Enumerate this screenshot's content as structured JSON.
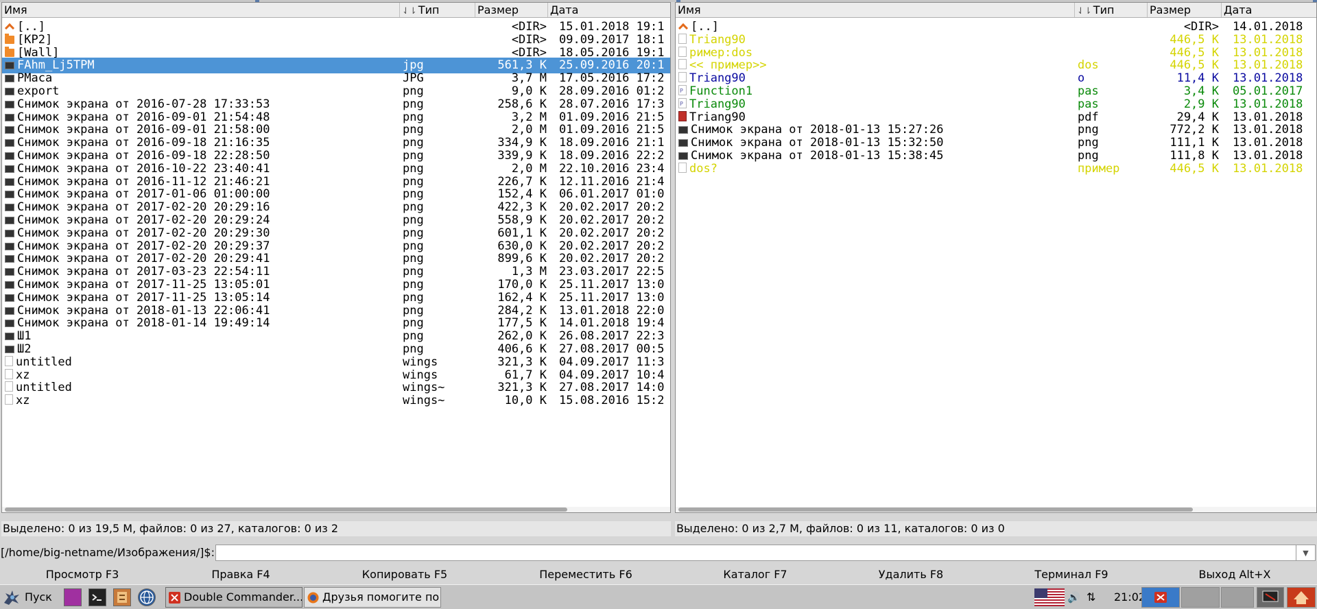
{
  "left_panel": {
    "columns": {
      "name": "Имя",
      "type": "Тип",
      "size": "Размер",
      "date": "Дата"
    },
    "rows": [
      {
        "icon": "up",
        "name": "[..]",
        "type": "",
        "size": "<DIR>",
        "date": "15.01.2018 19:1"
      },
      {
        "icon": "folder",
        "name": "[KP2]",
        "type": "",
        "size": "<DIR>",
        "date": "09.09.2017 18:1"
      },
      {
        "icon": "folder",
        "name": "[Wall]",
        "type": "",
        "size": "<DIR>",
        "date": "18.05.2016 19:1"
      },
      {
        "icon": "image",
        "name": "FAhm_Lj5TPM",
        "type": "jpg",
        "size": "561,3 K",
        "date": "25.09.2016 20:1",
        "selected": true
      },
      {
        "icon": "image",
        "name": "PMaca",
        "type": "JPG",
        "size": "3,7 M",
        "date": "17.05.2016 17:2"
      },
      {
        "icon": "image",
        "name": "export",
        "type": "png",
        "size": "9,0 K",
        "date": "28.09.2016 01:2"
      },
      {
        "icon": "image",
        "name": "Снимок экрана от 2016-07-28 17:33:53",
        "type": "png",
        "size": "258,6 K",
        "date": "28.07.2016 17:3"
      },
      {
        "icon": "image",
        "name": "Снимок экрана от 2016-09-01 21:54:48",
        "type": "png",
        "size": "3,2 M",
        "date": "01.09.2016 21:5"
      },
      {
        "icon": "image",
        "name": "Снимок экрана от 2016-09-01 21:58:00",
        "type": "png",
        "size": "2,0 M",
        "date": "01.09.2016 21:5"
      },
      {
        "icon": "image",
        "name": "Снимок экрана от 2016-09-18 21:16:35",
        "type": "png",
        "size": "334,9 K",
        "date": "18.09.2016 21:1"
      },
      {
        "icon": "image",
        "name": "Снимок экрана от 2016-09-18 22:28:50",
        "type": "png",
        "size": "339,9 K",
        "date": "18.09.2016 22:2"
      },
      {
        "icon": "image",
        "name": "Снимок экрана от 2016-10-22 23:40:41",
        "type": "png",
        "size": "2,0 M",
        "date": "22.10.2016 23:4"
      },
      {
        "icon": "image",
        "name": "Снимок экрана от 2016-11-12 21:46:21",
        "type": "png",
        "size": "226,7 K",
        "date": "12.11.2016 21:4"
      },
      {
        "icon": "image",
        "name": "Снимок экрана от 2017-01-06 01:00:00",
        "type": "png",
        "size": "152,4 K",
        "date": "06.01.2017 01:0"
      },
      {
        "icon": "image",
        "name": "Снимок экрана от 2017-02-20 20:29:16",
        "type": "png",
        "size": "422,3 K",
        "date": "20.02.2017 20:2"
      },
      {
        "icon": "image",
        "name": "Снимок экрана от 2017-02-20 20:29:24",
        "type": "png",
        "size": "558,9 K",
        "date": "20.02.2017 20:2"
      },
      {
        "icon": "image",
        "name": "Снимок экрана от 2017-02-20 20:29:30",
        "type": "png",
        "size": "601,1 K",
        "date": "20.02.2017 20:2"
      },
      {
        "icon": "image",
        "name": "Снимок экрана от 2017-02-20 20:29:37",
        "type": "png",
        "size": "630,0 K",
        "date": "20.02.2017 20:2"
      },
      {
        "icon": "image",
        "name": "Снимок экрана от 2017-02-20 20:29:41",
        "type": "png",
        "size": "899,6 K",
        "date": "20.02.2017 20:2"
      },
      {
        "icon": "image",
        "name": "Снимок экрана от 2017-03-23 22:54:11",
        "type": "png",
        "size": "1,3 M",
        "date": "23.03.2017 22:5"
      },
      {
        "icon": "image",
        "name": "Снимок экрана от 2017-11-25 13:05:01",
        "type": "png",
        "size": "170,0 K",
        "date": "25.11.2017 13:0"
      },
      {
        "icon": "image",
        "name": "Снимок экрана от 2017-11-25 13:05:14",
        "type": "png",
        "size": "162,4 K",
        "date": "25.11.2017 13:0"
      },
      {
        "icon": "image",
        "name": "Снимок экрана от 2018-01-13 22:06:41",
        "type": "png",
        "size": "284,2 K",
        "date": "13.01.2018 22:0"
      },
      {
        "icon": "image",
        "name": "Снимок экрана от 2018-01-14 19:49:14",
        "type": "png",
        "size": "177,5 K",
        "date": "14.01.2018 19:4"
      },
      {
        "icon": "image",
        "name": "Ш1",
        "type": "png",
        "size": "262,0 K",
        "date": "26.08.2017 22:3"
      },
      {
        "icon": "image",
        "name": "Ш2",
        "type": "png",
        "size": "406,6 K",
        "date": "27.08.2017 00:5"
      },
      {
        "icon": "doc",
        "name": "untitled",
        "type": "wings",
        "size": "321,3 K",
        "date": "04.09.2017 11:3"
      },
      {
        "icon": "doc",
        "name": "xz",
        "type": "wings",
        "size": "61,7 K",
        "date": "04.09.2017 10:4"
      },
      {
        "icon": "doc",
        "name": "untitled",
        "type": "wings~",
        "size": "321,3 K",
        "date": "27.08.2017 14:0"
      },
      {
        "icon": "doc",
        "name": "xz",
        "type": "wings~",
        "size": "10,0 K",
        "date": "15.08.2016 15:2"
      }
    ],
    "status": "Выделено: 0 из 19,5 M, файлов: 0 из 27, каталогов: 0 из 2"
  },
  "right_panel": {
    "columns": {
      "name": "Имя",
      "type": "Тип",
      "size": "Размер",
      "date": "Дата"
    },
    "rows": [
      {
        "icon": "up",
        "name": "[..]",
        "type": "",
        "size": "<DIR>",
        "date": "14.01.2018",
        "color": "#000000"
      },
      {
        "icon": "doc",
        "name": "Triang90",
        "type": "",
        "size": "446,5 K",
        "date": "13.01.2018",
        "color": "#d4d400"
      },
      {
        "icon": "doc",
        "name": "ример:dos",
        "type": "",
        "size": "446,5 K",
        "date": "13.01.2018",
        "color": "#d4d400"
      },
      {
        "icon": "doc",
        "name": "<< пример>>",
        "type": "dos",
        "size": "446,5 K",
        "date": "13.01.2018",
        "color": "#d4d400"
      },
      {
        "icon": "doc",
        "name": "Triang90",
        "type": "o",
        "size": "11,4 K",
        "date": "13.01.2018",
        "color": "#0a0aa0"
      },
      {
        "icon": "pascal",
        "name": "Function1",
        "type": "pas",
        "size": "3,4 K",
        "date": "05.01.2017",
        "color": "#0a8a0a"
      },
      {
        "icon": "pascal",
        "name": "Triang90",
        "type": "pas",
        "size": "2,9 K",
        "date": "13.01.2018",
        "color": "#0a8a0a"
      },
      {
        "icon": "pdf",
        "name": "Triang90",
        "type": "pdf",
        "size": "29,4 K",
        "date": "13.01.2018",
        "color": "#000000"
      },
      {
        "icon": "image",
        "name": "Снимок экрана от 2018-01-13 15:27:26",
        "type": "png",
        "size": "772,2 K",
        "date": "13.01.2018",
        "color": "#000000"
      },
      {
        "icon": "image",
        "name": "Снимок экрана от 2018-01-13 15:32:50",
        "type": "png",
        "size": "111,1 K",
        "date": "13.01.2018",
        "color": "#000000"
      },
      {
        "icon": "image",
        "name": "Снимок экрана от 2018-01-13 15:38:45",
        "type": "png",
        "size": "111,8 K",
        "date": "13.01.2018",
        "color": "#000000"
      },
      {
        "icon": "doc",
        "name": "dos?",
        "type": "пример",
        "size": "446,5 K",
        "date": "13.01.2018",
        "color": "#d4d400"
      }
    ],
    "status": "Выделено: 0 из 2,7 M, файлов: 0 из 11, каталогов: 0 из 0"
  },
  "command_line": {
    "prompt": "[/home/big-netname/Изображения/]$:",
    "value": ""
  },
  "function_keys": [
    {
      "name": "view",
      "label": "Просмотр F3"
    },
    {
      "name": "edit",
      "label": "Правка F4"
    },
    {
      "name": "copy",
      "label": "Копировать F5"
    },
    {
      "name": "move",
      "label": "Переместить F6"
    },
    {
      "name": "mkdir",
      "label": "Каталог F7"
    },
    {
      "name": "delete",
      "label": "Удалить F8"
    },
    {
      "name": "terminal",
      "label": "Терминал F9"
    },
    {
      "name": "exit",
      "label": "Выход Alt+X"
    }
  ],
  "taskbar": {
    "start_label": "Пуск",
    "tasks": [
      {
        "label": "Double Commander...",
        "icon": "double-commander-icon",
        "active": true
      },
      {
        "label": "Друзья помогите по...",
        "icon": "firefox-icon",
        "active": false
      }
    ],
    "clock": "21:02"
  },
  "colors": {
    "selection": "#4d94d6",
    "panel_bg": "#ffffff",
    "chrome_bg": "#d6d6d6"
  }
}
